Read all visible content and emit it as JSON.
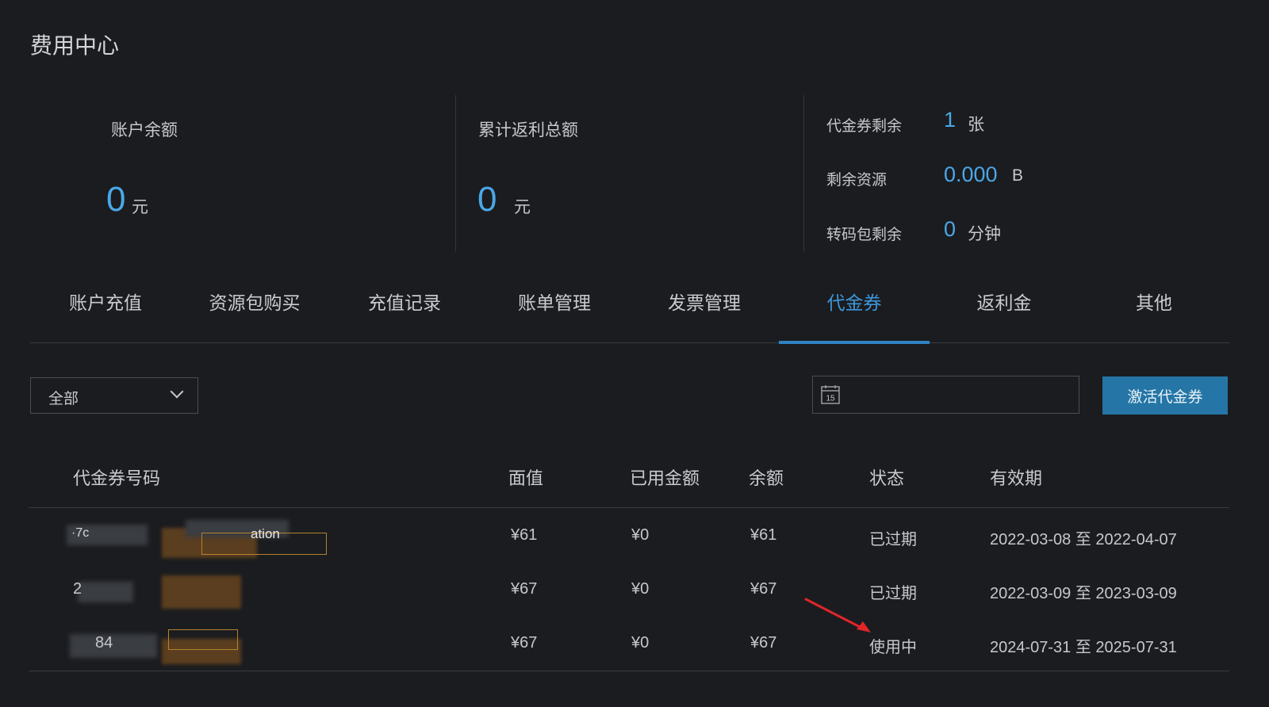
{
  "page": {
    "title": "费用中心"
  },
  "summary": {
    "balance": {
      "label": "账户余额",
      "value": "0",
      "unit": "元"
    },
    "rebate": {
      "label": "累计返利总额",
      "value": "0",
      "unit": "元"
    },
    "stats": [
      {
        "label": "代金券剩余",
        "value": "1",
        "unit": "张"
      },
      {
        "label": "剩余资源",
        "value": "0.000",
        "unit": "B"
      },
      {
        "label": "转码包剩余",
        "value": "0",
        "unit": "分钟"
      }
    ]
  },
  "tabs": [
    {
      "label": "账户充值",
      "active": false
    },
    {
      "label": "资源包购买",
      "active": false
    },
    {
      "label": "充值记录",
      "active": false
    },
    {
      "label": "账单管理",
      "active": false
    },
    {
      "label": "发票管理",
      "active": false
    },
    {
      "label": "代金券",
      "active": true
    },
    {
      "label": "返利金",
      "active": false
    },
    {
      "label": "其他",
      "active": false
    }
  ],
  "filter": {
    "status_select": "全部",
    "date_icon_day": "15",
    "activate_button": "激活代金券"
  },
  "table": {
    "headers": [
      "代金券号码",
      "面值",
      "已用金额",
      "余额",
      "状态",
      "有效期"
    ],
    "rows": [
      {
        "code_visible": "·7c",
        "tag_visible": "ation",
        "face": "¥61",
        "used": "¥0",
        "balance": "¥61",
        "status": "已过期",
        "validity": "2022-03-08 至 2022-04-07"
      },
      {
        "code_visible": "2",
        "tag_visible": "",
        "face": "¥67",
        "used": "¥0",
        "balance": "¥67",
        "status": "已过期",
        "validity": "2022-03-09 至 2023-03-09"
      },
      {
        "code_visible": "84",
        "tag_visible": "",
        "face": "¥67",
        "used": "¥0",
        "balance": "¥67",
        "status": "使用中",
        "validity": "2024-07-31 至 2025-07-31"
      }
    ]
  },
  "colors": {
    "accent": "#4aa8e8",
    "tab_active": "#3d97da",
    "button": "#2576a6",
    "annotation_arrow": "#e0262a"
  }
}
